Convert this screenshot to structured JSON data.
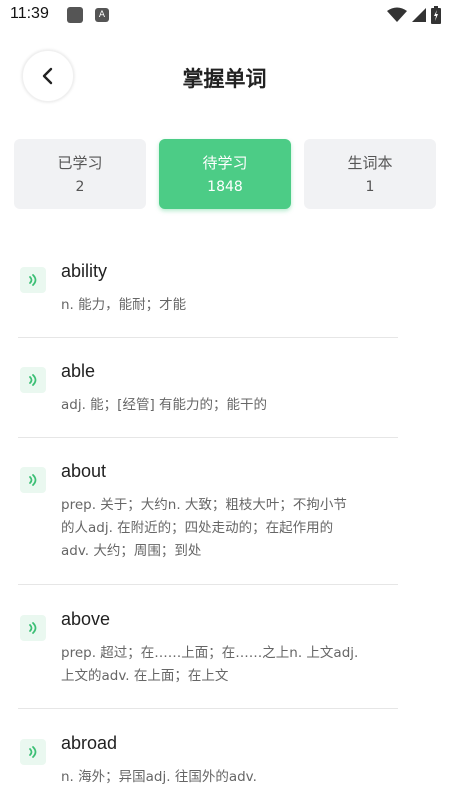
{
  "status": {
    "time": "11:39",
    "icons": [
      "notification-icon",
      "app-icon",
      "wifi-icon",
      "signal-icon",
      "battery-icon"
    ]
  },
  "header": {
    "title": "掌握单词",
    "back_icon": "chevron-left-icon"
  },
  "tabs": [
    {
      "label": "已学习",
      "count": "2",
      "active": false
    },
    {
      "label": "待学习",
      "count": "1848",
      "active": true
    },
    {
      "label": "生词本",
      "count": "1",
      "active": false
    }
  ],
  "words": [
    {
      "word": "ability",
      "meaning": "n. 能力，能耐；才能"
    },
    {
      "word": "able",
      "meaning": "adj. 能；[经管] 有能力的；能干的"
    },
    {
      "word": "about",
      "meaning_lines": [
        "prep. 关于；大约n. 大致；粗枝大叶；不拘小节",
        "的人adj. 在附近的；四处走动的；在起作用的",
        "adv. 大约；周围；到处"
      ]
    },
    {
      "word": "above",
      "meaning_lines": [
        "prep. 超过；在……上面；在……之上n. 上文adj.",
        "上文的adv. 在上面；在上文"
      ]
    },
    {
      "word": "abroad",
      "meaning": "n. 海外；异国adj. 往国外的adv."
    }
  ],
  "colors": {
    "accent": "#4ccc86",
    "tab_bg": "#f1f2f4",
    "speaker_bg": "#eaf8f0",
    "speaker_icon": "#3cbf75"
  }
}
